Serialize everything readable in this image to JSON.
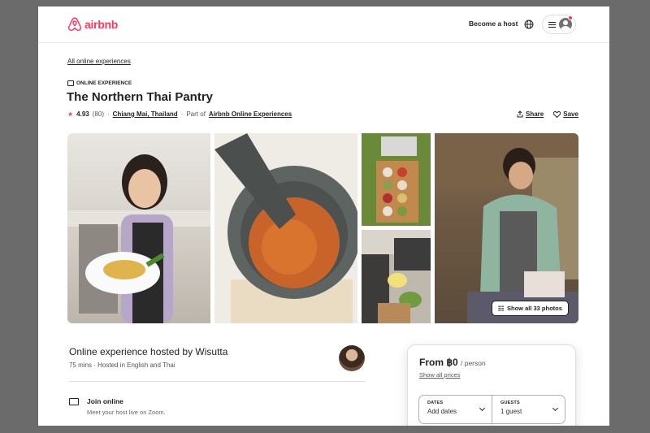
{
  "header": {
    "logo_text": "airbnb",
    "become_host": "Become a host",
    "brand_color": "#ff385c"
  },
  "breadcrumb": "All online experiences",
  "experience": {
    "type_label": "ONLINE EXPERIENCE",
    "title": "The Northern Thai Pantry",
    "rating": "4.93",
    "review_count": "(80)",
    "location": "Chiang Mai, Thailand",
    "part_of_prefix": "Part of",
    "part_of_link": "Airbnb Online Experiences",
    "share_label": "Share",
    "save_label": "Save"
  },
  "gallery": {
    "show_all_label": "Show all 33 photos"
  },
  "host": {
    "title": "Online experience hosted by Wisutta",
    "subtitle": "75 mins · Hosted in English and Thai"
  },
  "features": [
    {
      "title": "Join online",
      "subtitle": "Meet your host live on Zoom."
    }
  ],
  "booking": {
    "price": "From ฿0",
    "per": "/ person",
    "all_prices": "Show all prices",
    "dates_label": "DATES",
    "dates_value": "Add dates",
    "guests_label": "GUESTS",
    "guests_value": "1 guest"
  }
}
